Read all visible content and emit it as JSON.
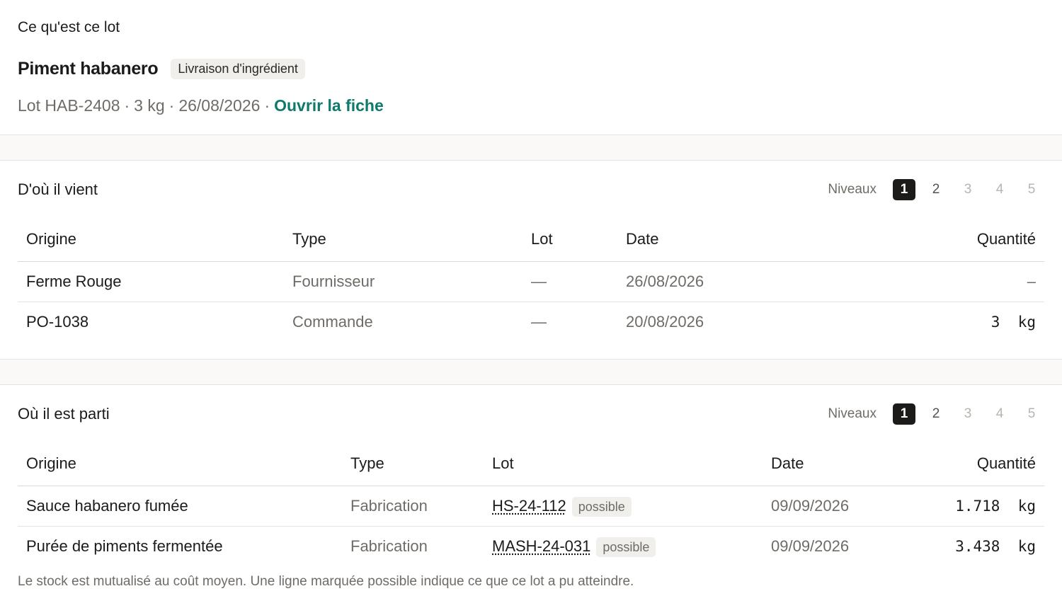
{
  "header": {
    "eyebrow": "Ce qu'est ce lot",
    "title": "Piment habanero",
    "chip": "Livraison d'ingrédient",
    "meta": {
      "lot": "Lot HAB-2408",
      "qty": "3 kg",
      "date": "26/08/2026",
      "sep": "·",
      "link": "Ouvrir la fiche"
    }
  },
  "levels_label": "Niveaux",
  "levels": [
    "1",
    "2",
    "3",
    "4",
    "5"
  ],
  "upstream": {
    "title": "D'où il vient",
    "columns": [
      "Origine",
      "Type",
      "Lot",
      "Date",
      "Quantité"
    ],
    "rows": [
      {
        "origin": "Ferme Rouge",
        "type": "Fournisseur",
        "lot": "—",
        "date": "26/08/2026",
        "qty": "–"
      },
      {
        "origin": "PO-1038",
        "type": "Commande",
        "lot": "—",
        "date": "20/08/2026",
        "qty": "3  kg"
      }
    ]
  },
  "downstream": {
    "title": "Où il est parti",
    "columns": [
      "Origine",
      "Type",
      "Lot",
      "Date",
      "Quantité"
    ],
    "rows": [
      {
        "origin": "Sauce habanero fumée",
        "type": "Fabrication",
        "lot": "HS-24-112",
        "badge": "possible",
        "date": "09/09/2026",
        "qty": "1.718  kg"
      },
      {
        "origin": "Purée de piments fermentée",
        "type": "Fabrication",
        "lot": "MASH-24-031",
        "badge": "possible",
        "date": "09/09/2026",
        "qty": "3.438  kg"
      }
    ]
  },
  "note": "Le stock est mutualisé au coût moyen. Une ligne marquée possible indique ce que ce lot a pu atteindre.",
  "colors": {
    "accent_link": "#0f7a6c",
    "level_active_bg": "#1c1b19",
    "chip_bg": "#f1efeb"
  }
}
